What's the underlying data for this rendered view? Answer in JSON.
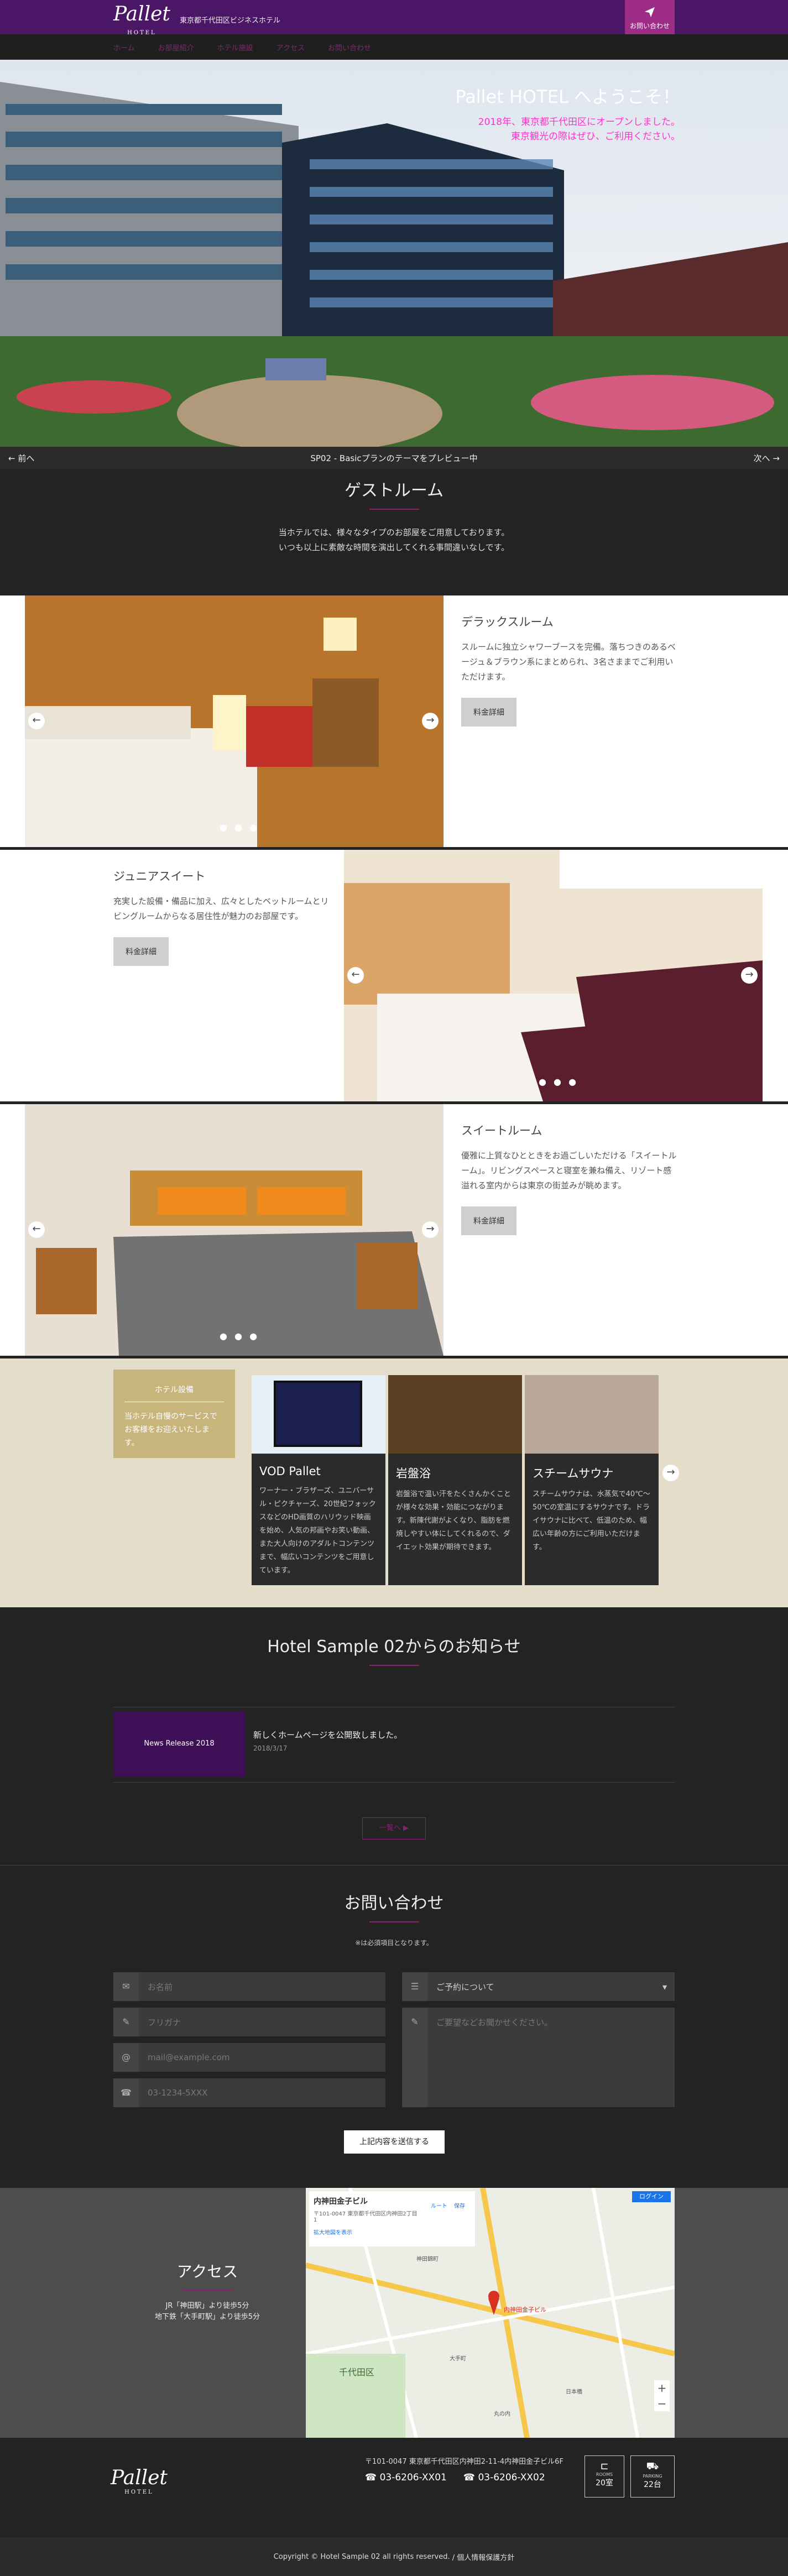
{
  "header": {
    "logo": "Pallet",
    "logo_sub": "HOTEL",
    "tagline": "東京都千代田区ビジネスホテル",
    "contact_label": "お問い合わせ"
  },
  "nav": {
    "items": [
      "ホーム",
      "お部屋紹介",
      "ホテル施設",
      "アクセス",
      "お問い合わせ"
    ]
  },
  "hero": {
    "title": "Pallet HOTEL へようこそ！",
    "subtitle_1": "2018年、東京都千代田区にオープンしました。",
    "subtitle_2": "東京観光の際はぜひ、ご利用ください。"
  },
  "preview_bar": {
    "prev": "← 前へ",
    "text": "SP02 - Basicプランのテーマをプレビュー中",
    "next": "次へ →"
  },
  "rooms_section": {
    "title": "ゲストルーム",
    "intro_1": "当ホテルでは、様々なタイプのお部屋をご用意しております。",
    "intro_2": "いつも以上に素敵な時間を演出してくれる事間違いなしです。"
  },
  "rooms": [
    {
      "name": "デラックスルーム",
      "desc": "スルームに独立シャワーブースを完備。落ちつきのあるベージュ＆ブラウン系にまとめられ、3名さままでご利用いただけます。",
      "button": "料金詳細"
    },
    {
      "name": "ジュニアスイート",
      "desc": "充実した設備・備品に加え、広々としたベットルームとリビングルームからなる居住性が魅力のお部屋です。",
      "button": "料金詳細"
    },
    {
      "name": "スイートルーム",
      "desc": "優雅に上質なひとときをお過ごしいただける「スイートルーム」。リビングスペースと寝室を兼ね備え、リゾート感溢れる室内からは東京の街並みが眺めます。",
      "button": "料金詳細"
    }
  ],
  "facilities": {
    "heading": "ホテル設備",
    "intro": "当ホテル自慢のサービスでお客様をお迎えいたします。",
    "cards": [
      {
        "name": "VOD Pallet",
        "desc": "ワーナー・ブラザーズ、ユニバーサル・ピクチャーズ、20世紀フォックスなどのHD画質のハリウッド映画を始め、人気の邦画やお笑い動画、また大人向けのアダルトコンテンツまで、幅広いコンテンツをご用意しています。"
      },
      {
        "name": "岩盤浴",
        "desc": "岩盤浴で温い汗をたくさんかくことが様々な効果・効能につながります。新陳代謝がよくなり、脂肪を燃焼しやすい体にしてくれるので、ダイエット効果が期待できます。"
      },
      {
        "name": "スチームサウナ",
        "desc": "スチームサウナは、水蒸気で40℃〜50℃の室温にするサウナです。ドライサウナに比べて、低温のため、幅広い年齢の方にご利用いただけます。"
      }
    ]
  },
  "news": {
    "title": "Hotel Sample 02からのお知らせ",
    "badge": "News Release 2018",
    "item_title": "新しくホームページを公開致しました。",
    "item_date": "2018/3/17",
    "more": "一覧へ ▶"
  },
  "contact": {
    "title": "お問い合わせ",
    "note": "※は必須項目となります。",
    "fields": {
      "name": "お名前",
      "kana": "フリガナ",
      "email": "mail@example.com",
      "tel": "03-1234-5XXX",
      "subject": "ご予約について",
      "message": "ご要望などお聞かせください。"
    },
    "submit": "上記内容を送信する"
  },
  "access": {
    "title": "アクセス",
    "line1": "JR「神田駅」より徒歩5分",
    "line2": "地下鉄「大手町駅」より徒歩5分",
    "map": {
      "place": "内神田金子ビル",
      "address": "〒101-0047 東京都千代田区内神田2丁目1",
      "route": "ルート",
      "save": "保存",
      "larger": "拡大地図を表示",
      "login": "ログイン",
      "pin": "内神田金子ビル",
      "district": "千代田区",
      "labels": [
        "神田錦町",
        "大手町",
        "丸の内",
        "日本橋"
      ]
    }
  },
  "footer": {
    "logo": "Pallet",
    "logo_sub": "HOTEL",
    "address": "〒101-0047 東京都千代田区内神田2-11-4内神田金子ビル6F",
    "tel1": "03-6206-XX01",
    "tel2": "03-6206-XX02",
    "rooms_label": "ROOMS",
    "rooms": "20室",
    "parking_label": "PARKING",
    "parking": "22台",
    "copyright": "Copyright © Hotel Sample 02 all rights reserved.",
    "privacy": "/ 個人情報保護方針"
  }
}
